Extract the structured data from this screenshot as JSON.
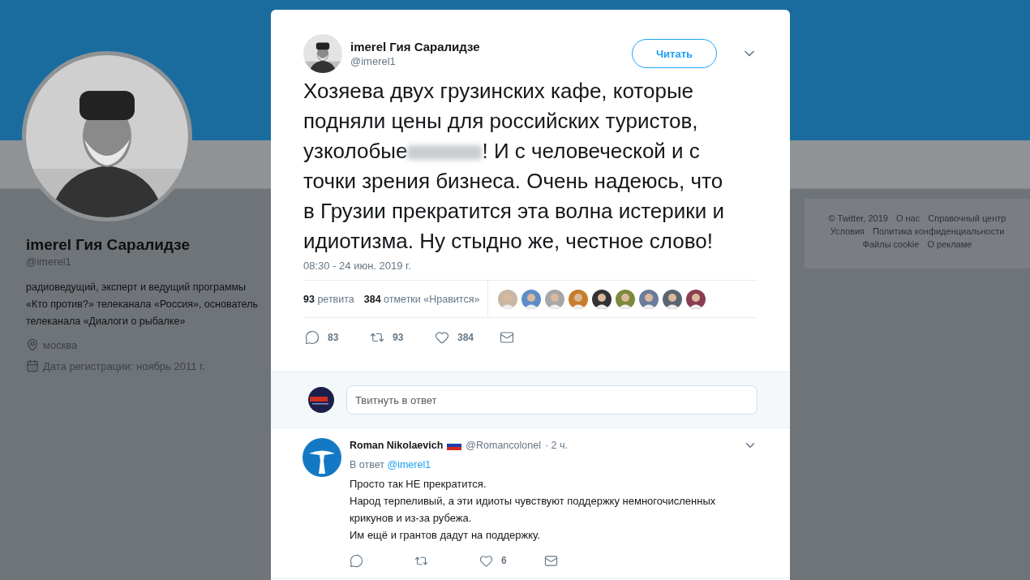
{
  "profile": {
    "name": "imerel Гия Саралидзе",
    "handle": "@imerel1",
    "bio": "радиоведущий, эксперт и ведущий программы «Кто против?» телеканала «Россия», основатель телеканала «Диалоги о рыбалке»",
    "location": "москва",
    "joined": "Дата регистрации: ноябрь 2011 г."
  },
  "footer_links": [
    "© Twitter, 2019",
    "О нас",
    "Справочный центр",
    "Условия",
    "Политика конфиденциальности",
    "Файлы cookie",
    "О рекламе"
  ],
  "tweet": {
    "author": "imerel Гия Саралидзе",
    "handle": "@imerel1",
    "follow_button": "Читать",
    "lines_before": [
      "Хозяева двух грузинских кафе, которые",
      "подняли цены для российских туристов,"
    ],
    "redacted_line": {
      "before": "узколобые",
      "redacted": true,
      "after": "! И с человеческой и с"
    },
    "lines_after": [
      "точки зрения бизнеса. Очень надеюсь, что",
      "в Грузии прекратится эта волна истерики и",
      "идиотизма. Ну стыдно же, честное слово!"
    ],
    "timestamp": "08:30 - 24 июн. 2019 г.",
    "retweets_count": "93",
    "retweets_label": "ретвита",
    "likes_count": "384",
    "likes_label": "отметки «Нравится»",
    "likers": [
      {
        "kind": "picture"
      },
      {
        "kind": "picture"
      },
      {
        "kind": "picture"
      },
      {
        "kind": "picture"
      },
      {
        "kind": "picture"
      },
      {
        "kind": "picture"
      },
      {
        "kind": "picture"
      },
      {
        "kind": "picture"
      },
      {
        "kind": "picture"
      }
    ],
    "actions": [
      {
        "kind": "reply",
        "count": "83"
      },
      {
        "kind": "retweet",
        "count": "93"
      },
      {
        "kind": "like",
        "count": "384"
      },
      {
        "kind": "message"
      }
    ]
  },
  "reply_box": {
    "placeholder": "Твитнуть в ответ"
  },
  "replies": [
    {
      "author": "Roman Nikolaevich",
      "handle": "@Romancolonel",
      "time": "· 2 ч.",
      "reply_to_label": "В ответ",
      "reply_to": "@imerel1",
      "lines": [
        "Просто так НЕ прекратится.",
        "Народ терпеливый, а эти идиоты чувствуют поддержку немногочисленных крикунов и из-за рубежа.",
        "Им ещё и грантов дадут на поддержку."
      ],
      "actions": [
        {
          "kind": "reply"
        },
        {
          "kind": "retweet"
        },
        {
          "kind": "like",
          "count": "6"
        },
        {
          "kind": "message"
        }
      ]
    }
  ]
}
